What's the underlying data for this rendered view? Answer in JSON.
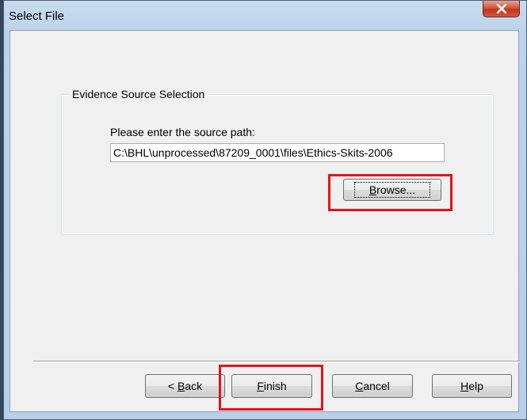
{
  "window": {
    "title": "Select File"
  },
  "group": {
    "legend": "Evidence Source Selection",
    "prompt": "Please enter the source path:",
    "path_value": "C:\\BHL\\unprocessed\\87209_0001\\files\\Ethics-Skits-2006",
    "browse": {
      "pre": "",
      "key": "B",
      "post": "rowse..."
    }
  },
  "buttons": {
    "back": {
      "pre": "< ",
      "key": "B",
      "post": "ack"
    },
    "finish": {
      "pre": "",
      "key": "F",
      "post": "inish"
    },
    "cancel": {
      "pre": "",
      "key": "C",
      "post": "ancel"
    },
    "help": {
      "pre": "",
      "key": "H",
      "post": "elp"
    }
  },
  "colors": {
    "highlight": "#e3141c",
    "close_button": "#c2351c"
  }
}
